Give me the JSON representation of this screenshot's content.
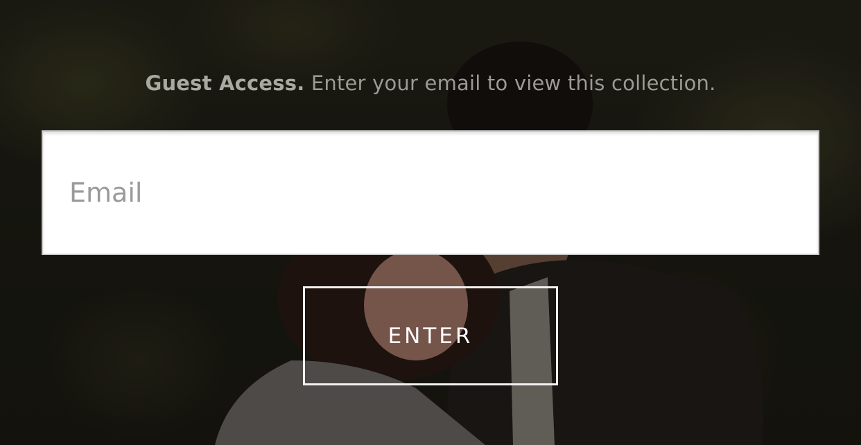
{
  "guest_access": {
    "title_strong": "Guest Access.",
    "title_rest": " Enter your email to view this collection.",
    "email_placeholder": "Email",
    "email_value": "",
    "enter_label": "ENTER"
  },
  "colors": {
    "button_border": "#f2f2f2",
    "input_background": "#ffffff",
    "headline_text": "#9b9a94"
  }
}
